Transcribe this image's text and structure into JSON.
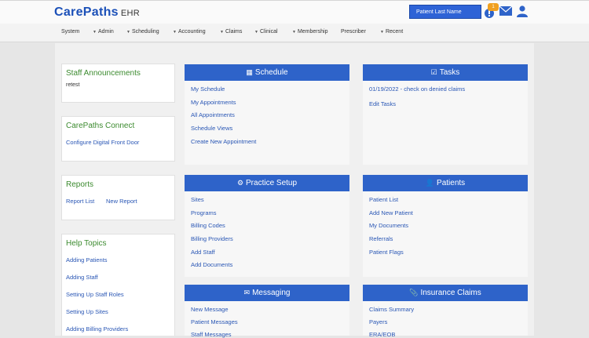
{
  "header": {
    "logo_main": "CarePaths",
    "logo_sub": "EHR",
    "search_placeholder": "Patient Last Name",
    "notification_count": "1"
  },
  "nav": {
    "items": [
      {
        "label": "System",
        "has_caret": false
      },
      {
        "label": "Admin",
        "has_caret": true
      },
      {
        "label": "Scheduling",
        "has_caret": true
      },
      {
        "label": "Accounting",
        "has_caret": true
      },
      {
        "label": "Claims",
        "has_caret": true
      },
      {
        "label": "Clinical",
        "has_caret": true
      },
      {
        "label": "Membership",
        "has_caret": true
      },
      {
        "label": "Prescriber",
        "has_caret": false
      },
      {
        "label": "Recent",
        "has_caret": true
      }
    ]
  },
  "sidebar": {
    "announcements": {
      "title": "Staff Announcements",
      "text": "retest"
    },
    "connect": {
      "title": "CarePaths Connect",
      "link": "Configure Digital Front Door"
    },
    "reports": {
      "title": "Reports",
      "links": [
        "Report List",
        "New Report"
      ]
    },
    "help": {
      "title": "Help Topics",
      "links": [
        "Adding Patients",
        "Adding Staff",
        "Setting Up Staff Roles",
        "Setting Up Sites",
        "Adding Billing Providers"
      ]
    }
  },
  "panels": {
    "schedule": {
      "title": "Schedule",
      "icon": "calendar-icon",
      "links": [
        "My Schedule",
        "My Appointments",
        "All Appointments",
        "Schedule Views",
        "Create New Appointment"
      ]
    },
    "tasks": {
      "title": "Tasks",
      "icon": "checkbox-icon",
      "links": [
        "01/19/2022 - check on denied claims",
        "Edit Tasks"
      ]
    },
    "practice": {
      "title": "Practice Setup",
      "icon": "gear-icon",
      "links": [
        "Sites",
        "Programs",
        "Billing Codes",
        "Billing Providers",
        "Add Staff",
        "Add Documents"
      ]
    },
    "patients": {
      "title": "Patients",
      "icon": "user-icon",
      "links": [
        "Patient List",
        "Add New Patient",
        "My Documents",
        "Referrals",
        "Patient Flags"
      ]
    },
    "messaging": {
      "title": "Messaging",
      "icon": "envelope-icon",
      "links": [
        "New Message",
        "Patient Messages",
        "Staff Messages"
      ]
    },
    "claims": {
      "title": "Insurance Claims",
      "icon": "paperclip-icon",
      "links": [
        "Claims Summary",
        "Payers",
        "ERA/EOB"
      ]
    }
  },
  "colors": {
    "brand_blue": "#2e63c9",
    "link_blue": "#2a57b5",
    "title_green": "#3b8a2e",
    "badge_orange": "#f0a020"
  }
}
